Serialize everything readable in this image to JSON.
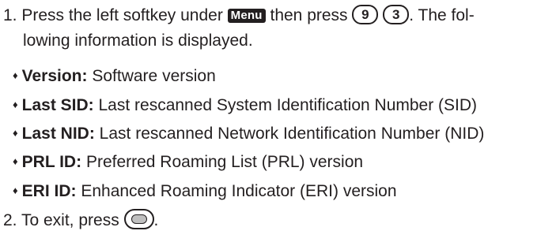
{
  "step1": {
    "number": "1.",
    "prefix": "Press the left softkey under",
    "menu_key": "Menu",
    "middle": "then press",
    "key_a": "9",
    "key_b": "3",
    "suffix": ". The fol-",
    "continuation": "lowing information is displayed."
  },
  "bullets": [
    {
      "term": "Version:",
      "text": "Software version"
    },
    {
      "term": "Last SID:",
      "text": "Last rescanned System Identification Number (SID)"
    },
    {
      "term": "Last NID:",
      "text": "Last rescanned Network Identification Number (NID)"
    },
    {
      "term": "PRL ID:",
      "text": "Preferred Roaming List (PRL) version"
    },
    {
      "term": "ERI ID:",
      "text": "Enhanced Roaming Indicator (ERI) version"
    }
  ],
  "bullet_glyph": "♦",
  "step2": {
    "number": "2.",
    "prefix": "To exit, press",
    "suffix": ".",
    "key_icon": "end-key-icon"
  }
}
